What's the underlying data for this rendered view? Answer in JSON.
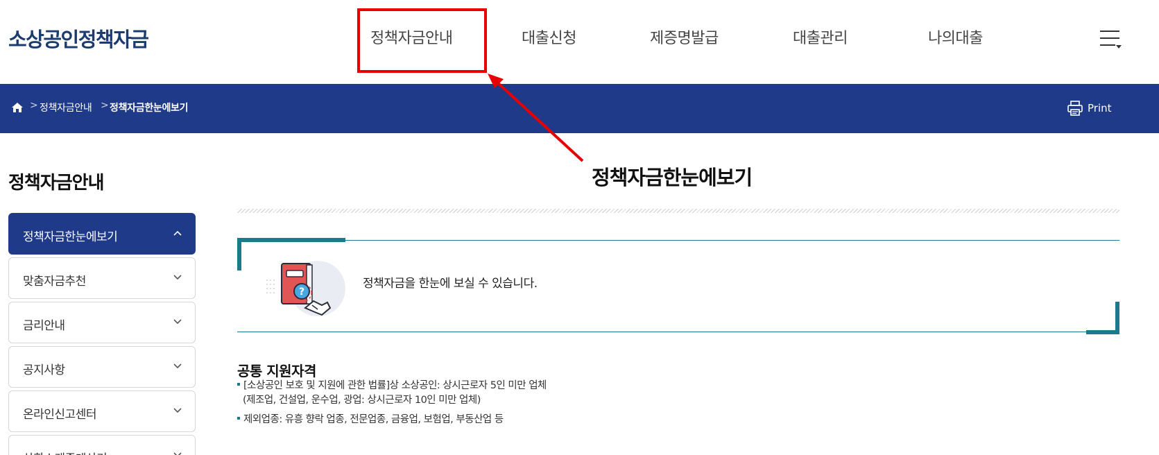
{
  "header": {
    "logo": "소상공인정책자금",
    "nav": [
      {
        "label": "정책자금안내"
      },
      {
        "label": "대출신청"
      },
      {
        "label": "제증명발급"
      },
      {
        "label": "대출관리"
      },
      {
        "label": "나의대출"
      }
    ],
    "menu_icon": "hamburger-menu-icon"
  },
  "breadcrumb": {
    "home_icon": "home-icon",
    "items": [
      "정책자금안내",
      "정책자금한눈에보기"
    ],
    "separator": ">",
    "print_label": "Print",
    "print_icon": "printer-icon",
    "bar_color": "#1e3a88"
  },
  "sidebar": {
    "title": "정책자금안내",
    "items": [
      {
        "label": "정책자금한눈에보기",
        "active": true
      },
      {
        "label": "맞춤자금추천"
      },
      {
        "label": "금리안내"
      },
      {
        "label": "공지사항"
      },
      {
        "label": "온라인신고센터"
      },
      {
        "label": "상환스케줄계산기"
      }
    ]
  },
  "main": {
    "page_title": "정책자금한눈에보기",
    "intro_text": "정책자금을 한눈에 보실 수 있습니다.",
    "intro_icon": "book-search-handshake-icon",
    "section_title": "공통 지원자격",
    "bullets": [
      [
        "[소상공인 보호 및 지원에 관한 법률]상 소상공인: 상시근로자 5인 미만 업체",
        "(제조업, 건설업, 운수업, 광업: 상시근로자 10인 미만 업체)"
      ],
      [
        "제외업종: 유흥 향락 업종, 전문업종, 금융업, 보험업, 부동산업 등"
      ]
    ]
  },
  "annotation": {
    "highlight_color": "#e60000"
  }
}
